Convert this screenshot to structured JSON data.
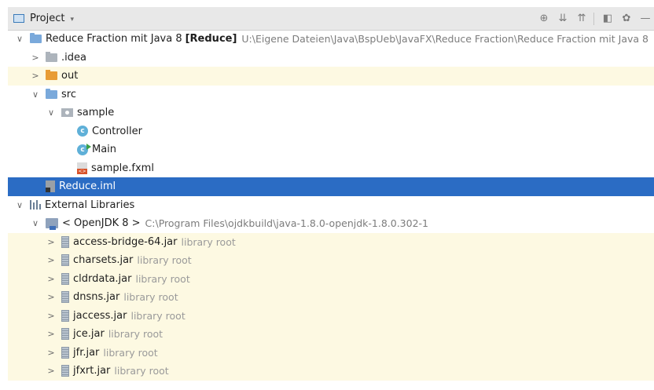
{
  "toolbar": {
    "title": "Project",
    "dropdown_glyph": "▾",
    "buttons": {
      "locate_glyph": "⊕",
      "expand_all_glyph": "⇊",
      "collapse_all_glyph": "⇈",
      "layout_glyph": "◧",
      "settings_glyph": "✿",
      "hide_glyph": "—"
    }
  },
  "tree": {
    "root": {
      "name": "Reduce Fraction mit Java 8",
      "module": "[Reduce]",
      "path": "U:\\Eigene Dateien\\Java\\BspUeb\\JavaFX\\Reduce Fraction\\Reduce Fraction mit Java 8"
    },
    "idea": {
      "name": ".idea"
    },
    "out": {
      "name": "out"
    },
    "src": {
      "name": "src"
    },
    "sample": {
      "name": "sample"
    },
    "controller": {
      "name": "Controller",
      "icon_letter": "c"
    },
    "main": {
      "name": "Main",
      "icon_letter": "c"
    },
    "fxml": {
      "name": "sample.fxml"
    },
    "iml": {
      "name": "Reduce.iml"
    },
    "external_libraries": {
      "name": "External Libraries"
    },
    "jdk": {
      "name": "< OpenJDK 8 >",
      "path": "C:\\Program Files\\ojdkbuild\\java-1.8.0-openjdk-1.8.0.302-1"
    },
    "jars": [
      {
        "name": "access-bridge-64.jar",
        "hint": "library root"
      },
      {
        "name": "charsets.jar",
        "hint": "library root"
      },
      {
        "name": "cldrdata.jar",
        "hint": "library root"
      },
      {
        "name": "dnsns.jar",
        "hint": "library root"
      },
      {
        "name": "jaccess.jar",
        "hint": "library root"
      },
      {
        "name": "jce.jar",
        "hint": "library root"
      },
      {
        "name": "jfr.jar",
        "hint": "library root"
      },
      {
        "name": "jfxrt.jar",
        "hint": "library root"
      }
    ],
    "arrow_collapsed": ">",
    "arrow_expanded": "∨"
  },
  "colors": {
    "selection": "#2b6cc4",
    "highlight_row": "#fdf9e2",
    "toolbar_bg": "#e8e8e8"
  }
}
